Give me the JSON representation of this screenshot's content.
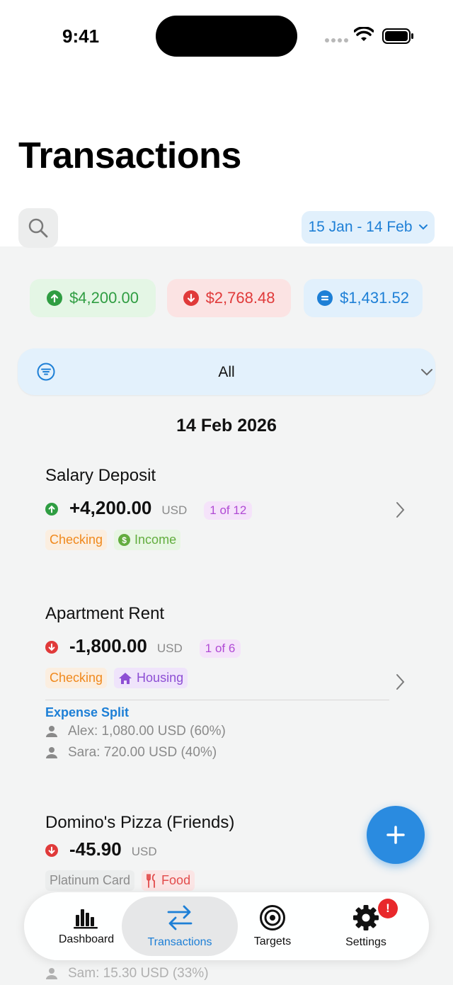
{
  "status_bar": {
    "time": "9:41"
  },
  "header": {
    "title": "Transactions"
  },
  "date_range": {
    "label": "15 Jan - 14 Feb"
  },
  "summary": {
    "income": "$4,200.00",
    "expense": "$2,768.48",
    "net": "$1,431.52",
    "colors": {
      "income": "#2f9d42",
      "expense": "#e03a3a",
      "net": "#1d7fd6"
    }
  },
  "filter": {
    "selected": "All"
  },
  "date_group": {
    "label": "14 Feb 2026"
  },
  "transactions": [
    {
      "name": "Salary Deposit",
      "direction": "up",
      "amount": "+4,200.00",
      "currency": "USD",
      "recurrence": "1 of 12",
      "account": "Checking",
      "category": "Income",
      "category_icon": "dollar-icon"
    },
    {
      "name": "Apartment Rent",
      "direction": "down",
      "amount": "-1,800.00",
      "currency": "USD",
      "recurrence": "1 of 6",
      "account": "Checking",
      "category": "Housing",
      "category_icon": "house-icon",
      "split": {
        "title": "Expense Split",
        "people": [
          "Alex: 1,080.00 USD (60%)",
          "Sara: 720.00 USD (40%)"
        ]
      }
    },
    {
      "name": "Domino's Pizza (Friends)",
      "direction": "down",
      "amount": "-45.90",
      "currency": "USD",
      "account": "Platinum Card",
      "category": "Food",
      "category_icon": "fork-knife-icon",
      "split": {
        "people": [
          "Sam: 15.30 USD (33%)"
        ]
      }
    }
  ],
  "tab_bar": {
    "tabs": [
      {
        "label": "Dashboard",
        "icon": "bar-chart-icon",
        "active": false
      },
      {
        "label": "Transactions",
        "icon": "transfer-arrows-icon",
        "active": true
      },
      {
        "label": "Targets",
        "icon": "target-icon",
        "active": false
      },
      {
        "label": "Settings",
        "icon": "gear-icon",
        "active": false
      }
    ],
    "settings_badge": "!"
  }
}
